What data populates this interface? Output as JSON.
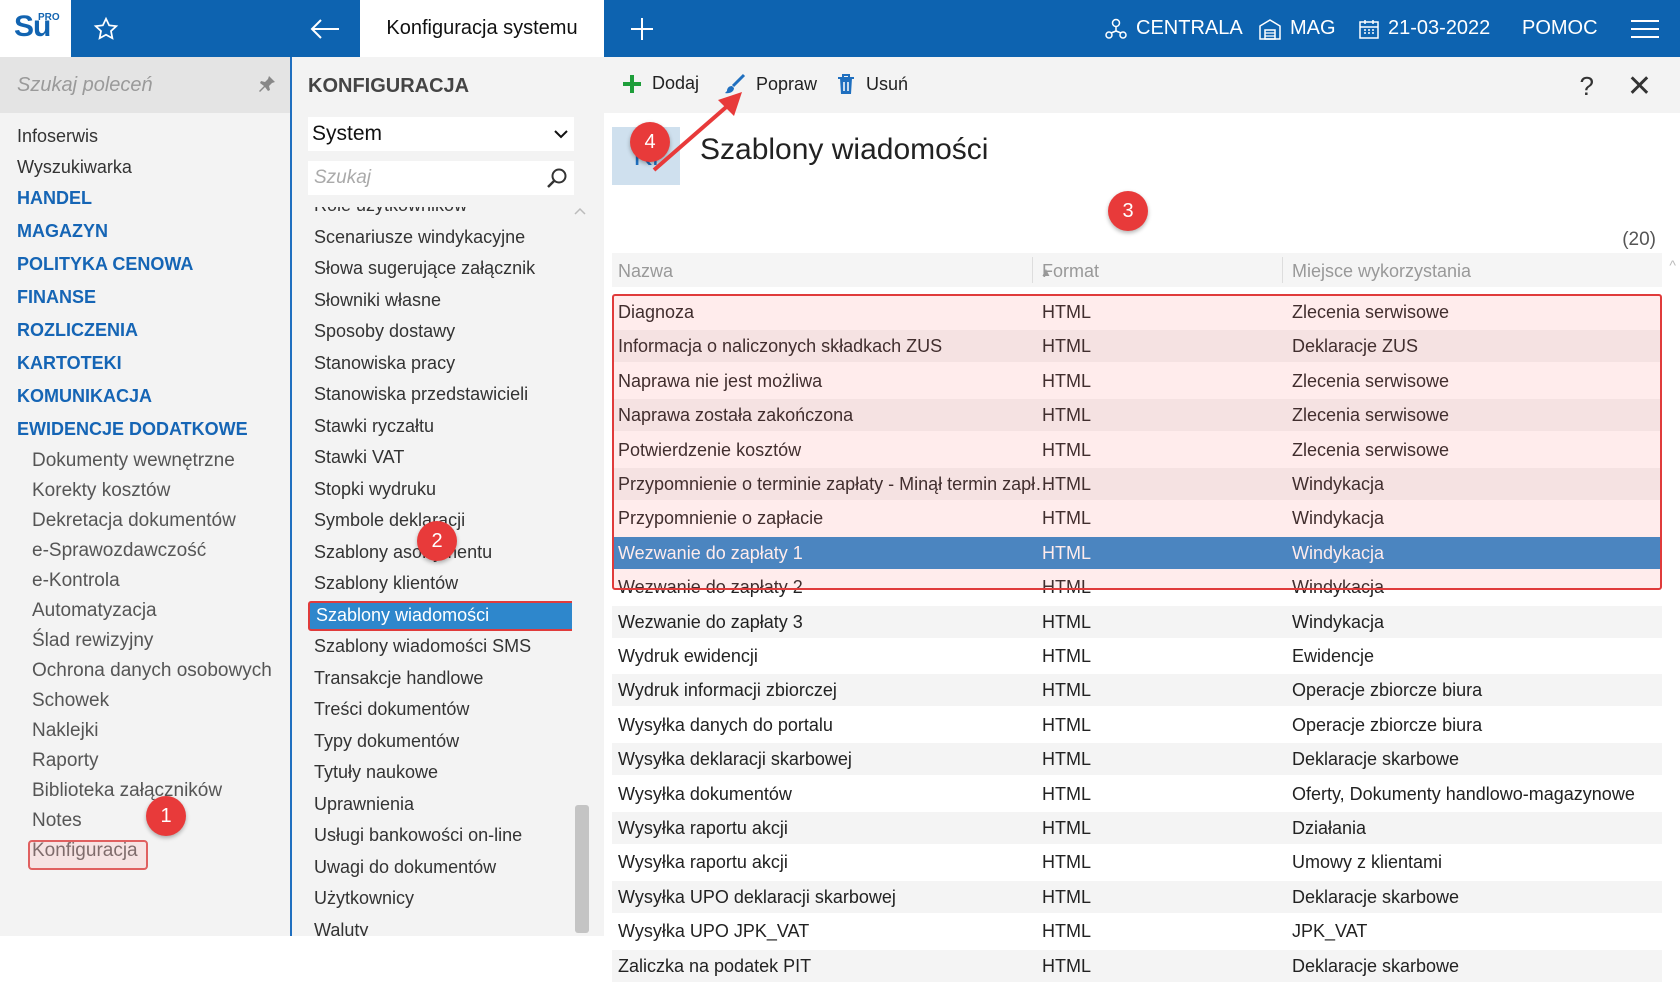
{
  "topbar": {
    "logo_text": "Su",
    "logo_sup": "PRO",
    "active_tab": "Konfiguracja systemu",
    "centrala": "CENTRALA",
    "mag": "MAG",
    "date": "21-03-2022",
    "help": "POMOC",
    "icons": [
      "star-icon",
      "back-arrow-icon",
      "plus-icon",
      "network-icon",
      "warehouse-icon",
      "calendar-icon",
      "hamburger-icon"
    ]
  },
  "left": {
    "search_placeholder": "Szukaj poleceń",
    "items": [
      "Infoserwis",
      "Wyszukiwarka"
    ],
    "sections": [
      "HANDEL",
      "MAGAZYN",
      "POLITYKA CENOWA",
      "FINANSE",
      "ROZLICZENIA",
      "KARTOTEKI",
      "KOMUNIKACJA",
      "EWIDENCJE DODATKOWE"
    ],
    "subitems": [
      "Dokumenty wewnętrzne",
      "Korekty kosztów",
      "Dekretacja dokumentów",
      "e-Sprawozdawczość",
      "e-Kontrola",
      "Automatyzacja",
      "Ślad rewizyjny",
      "Ochrona danych osobowych",
      "Schowek",
      "Naklejki",
      "Raporty",
      "Biblioteka załączników",
      "Notes",
      "Konfiguracja"
    ]
  },
  "middle": {
    "title": "KONFIGURACJA",
    "select_value": "System",
    "search_placeholder": "Szukaj",
    "partial_item": "Role użytkowników",
    "items": [
      "Scenariusze windykacyjne",
      "Słowa sugerujące załącznik",
      "Słowniki własne",
      "Sposoby dostawy",
      "Stanowiska pracy",
      "Stanowiska przedstawicieli",
      "Stawki ryczałtu",
      "Stawki VAT",
      "Stopki wydruku",
      "Symbole deklaracji",
      "Szablony asortymentu",
      "Szablony klientów"
    ],
    "selected": "Szablony wiadomości",
    "items_after": [
      "Szablony wiadomości SMS",
      "Transakcje handlowe",
      "Treści dokumentów",
      "Typy dokumentów",
      "Tytuły naukowe",
      "Uprawnienia",
      "Usługi bankowości on-line",
      "Uwagi do dokumentów",
      "Użytkownicy",
      "Waluty"
    ]
  },
  "main": {
    "toolbar": {
      "add": "Dodaj",
      "edit": "Popraw",
      "delete": "Usuń",
      "help": "?",
      "close": "✕"
    },
    "badge": "Kl",
    "title": "Szablony wiadomości",
    "count": "(20)",
    "columns": [
      "Nazwa",
      "Format",
      "Miejsce wykorzystania"
    ],
    "rows": [
      [
        "Diagnoza",
        "HTML",
        "Zlecenia serwisowe"
      ],
      [
        "Informacja o naliczonych składkach ZUS",
        "HTML",
        "Deklaracje ZUS"
      ],
      [
        "Naprawa nie jest możliwa",
        "HTML",
        "Zlecenia serwisowe"
      ],
      [
        "Naprawa została zakończona",
        "HTML",
        "Zlecenia serwisowe"
      ],
      [
        "Potwierdzenie kosztów",
        "HTML",
        "Zlecenia serwisowe"
      ],
      [
        "Przypomnienie o terminie zapłaty - Minął termin zapłaty",
        "HTML",
        "Windykacja"
      ],
      [
        "Przypomnienie o zapłacie",
        "HTML",
        "Windykacja"
      ],
      [
        "Wezwanie do zapłaty 1",
        "HTML",
        "Windykacja"
      ],
      [
        "Wezwanie do zapłaty 2",
        "HTML",
        "Windykacja"
      ],
      [
        "Wezwanie do zapłaty 3",
        "HTML",
        "Windykacja"
      ],
      [
        "Wydruk ewidencji",
        "HTML",
        "Ewidencje"
      ],
      [
        "Wydruk informacji zbiorczej",
        "HTML",
        "Operacje zbiorcze biura"
      ],
      [
        "Wysyłka danych do portalu",
        "HTML",
        "Operacje zbiorcze biura"
      ],
      [
        "Wysyłka deklaracji skarbowej",
        "HTML",
        "Deklaracje skarbowe"
      ],
      [
        "Wysyłka dokumentów",
        "HTML",
        "Oferty, Dokumenty handlowo-magazynowe"
      ],
      [
        "Wysyłka raportu akcji",
        "HTML",
        "Działania"
      ],
      [
        "Wysyłka raportu akcji",
        "HTML",
        "Umowy z klientami"
      ],
      [
        "Wysyłka UPO deklaracji skarbowej",
        "HTML",
        "Deklaracje skarbowe"
      ],
      [
        "Wysyłka UPO JPK_VAT",
        "HTML",
        "JPK_VAT"
      ],
      [
        "Zaliczka na podatek PIT",
        "HTML",
        "Deklaracje skarbowe"
      ]
    ],
    "selected_row": 7
  },
  "annotations": [
    "1",
    "2",
    "3",
    "4"
  ],
  "colors": {
    "brand": "#0d63b0",
    "selection": "#2e87cc",
    "annotation": "#e83a3a"
  }
}
